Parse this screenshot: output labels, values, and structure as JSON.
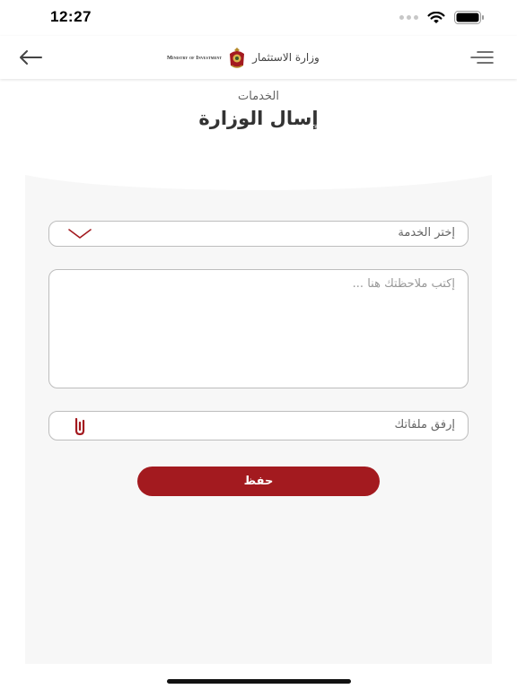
{
  "status_bar": {
    "time": "12:27"
  },
  "header": {
    "logo_en": "Ministry of Investment",
    "logo_ar": "وزارة الاستثمار"
  },
  "page": {
    "subtitle": "الخدمات",
    "title": "إسال الوزارة"
  },
  "form": {
    "service_select": {
      "placeholder": "إختر الخدمة"
    },
    "notes": {
      "placeholder": "إكتب ملاحظتك هنا ...",
      "value": ""
    },
    "attachment": {
      "label": "إرفق ملفاتك"
    },
    "save_label": "حفظ"
  },
  "colors": {
    "accent": "#a31a1f",
    "panel_background": "#f7f7f7",
    "field_border": "#bdbdbd"
  },
  "icons": {
    "back": "arrow-left-icon",
    "menu": "hamburger-menu-icon",
    "select": "chevron-down-icon",
    "attach": "paperclip-icon"
  }
}
